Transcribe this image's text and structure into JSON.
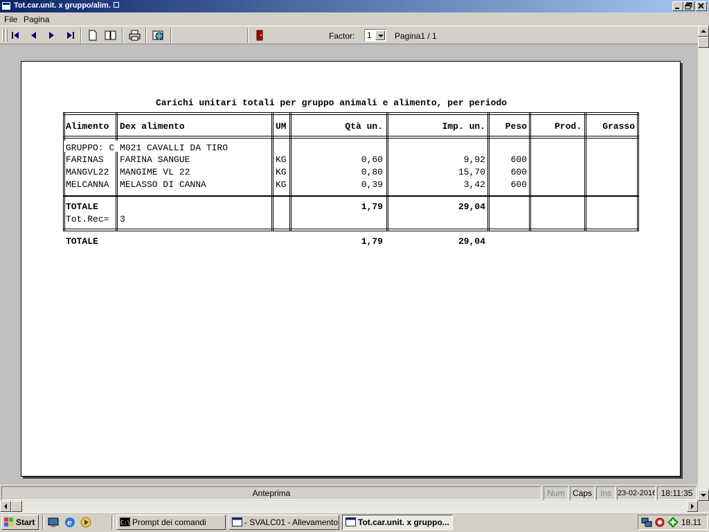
{
  "window": {
    "title": "Tot.car.unit. x gruppo/alim.",
    "buttons": {
      "minimize": "_",
      "maximize": "□",
      "close": "×"
    }
  },
  "menu": {
    "items": [
      "File",
      "Pagina"
    ]
  },
  "toolbar": {
    "factor_label": "Factor:",
    "factor_value": "1",
    "page_info": "Pagina1 / 1"
  },
  "report": {
    "title": "Carichi unitari totali per gruppo animali e alimento, per periodo",
    "headers": {
      "alimento": "Alimento",
      "dex": "Dex alimento",
      "um": "UM",
      "qta": "Qtà un.",
      "imp": "Imp. un.",
      "peso": "Peso",
      "prod": "Prod.",
      "grasso": "Grasso"
    },
    "group_label": "GRUPPO: C M021 CAVALLI DA TIRO",
    "rows": [
      {
        "code": "FARINAS",
        "desc": "FARINA SANGUE",
        "um": "KG",
        "qta": "0,60",
        "imp": "9,92",
        "peso": "600"
      },
      {
        "code": "MANGVL22",
        "desc": "MANGIME VL 22",
        "um": "KG",
        "qta": "0,80",
        "imp": "15,70",
        "peso": "600"
      },
      {
        "code": "MELCANNA",
        "desc": "MELASSO DI CANNA",
        "um": "KG",
        "qta": "0,39",
        "imp": "3,42",
        "peso": "600"
      }
    ],
    "group_total": {
      "label": "TOTALE",
      "qta": "1,79",
      "imp": "29,04"
    },
    "tot_rec": {
      "label": "Tot.Rec=",
      "value": "3"
    },
    "grand_total": {
      "label": "TOTALE",
      "qta": "1,79",
      "imp": "29,04"
    }
  },
  "statusbar": {
    "main": "Anteprima",
    "num": "Num",
    "caps": "Caps",
    "ins": "Ins",
    "date": "23-02-2016",
    "time": "18:11:35"
  },
  "taskbar": {
    "start": "Start",
    "tasks": [
      "Prompt dei comandi",
      "- SVALC01 - Allevamento...",
      "Tot.car.unit. x gruppo..."
    ],
    "clock": "18.11"
  }
}
